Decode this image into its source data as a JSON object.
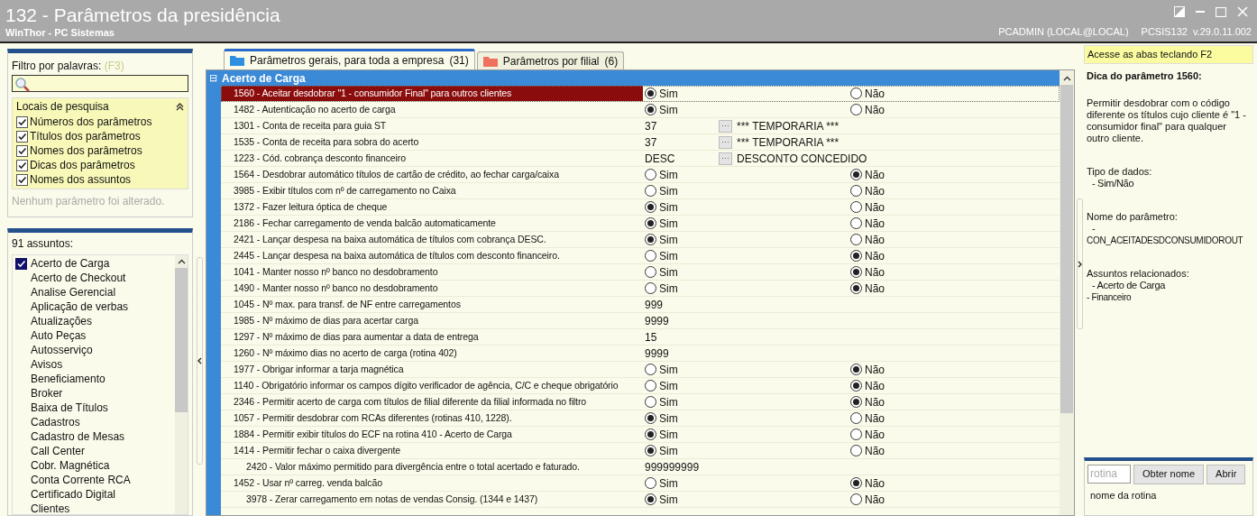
{
  "window": {
    "title": "132 - Parâmetros da presidência",
    "subtitle": "WinThor - PC Sistemas",
    "user": "PCADMIN (LOCAL@LOCAL)",
    "routine": "PCSIS132",
    "version": "v.29.0.11.002"
  },
  "filter": {
    "label": "Filtro por palavras:",
    "shortcut": "(F3)",
    "search_places_title": "Locais de pesquisa",
    "places": [
      {
        "label": "Números dos parâmetros",
        "checked": true
      },
      {
        "label": "Títulos dos parâmetros",
        "checked": true
      },
      {
        "label": "Nomes dos parâmetros",
        "checked": true
      },
      {
        "label": "Dicas dos parâmetros",
        "checked": true
      },
      {
        "label": "Nomes dos assuntos",
        "checked": true
      }
    ],
    "status": "Nenhum parâmetro foi alterado."
  },
  "subjects": {
    "count_label": "91 assuntos:",
    "items": [
      {
        "label": "Acerto de Carga",
        "selected": true
      },
      {
        "label": "Acerto de Checkout",
        "selected": false
      },
      {
        "label": "Analise Gerencial",
        "selected": false
      },
      {
        "label": "Aplicação de verbas",
        "selected": false
      },
      {
        "label": "Atualizações",
        "selected": false
      },
      {
        "label": "Auto Peças",
        "selected": false
      },
      {
        "label": "Autosserviço",
        "selected": false
      },
      {
        "label": "Avisos",
        "selected": false
      },
      {
        "label": "Beneficiamento",
        "selected": false
      },
      {
        "label": "Broker",
        "selected": false
      },
      {
        "label": "Baixa de Títulos",
        "selected": false
      },
      {
        "label": "Cadastros",
        "selected": false
      },
      {
        "label": "Cadastro de Mesas",
        "selected": false
      },
      {
        "label": "Call Center",
        "selected": false
      },
      {
        "label": "Cobr. Magnética",
        "selected": false
      },
      {
        "label": "Conta Corrente RCA",
        "selected": false
      },
      {
        "label": "Certificado Digital",
        "selected": false
      },
      {
        "label": "Clientes",
        "selected": false
      }
    ]
  },
  "tabs": [
    {
      "label": "Parâmetros gerais, para toda a empresa",
      "count": "(31)",
      "selected": true,
      "color": "#2f8fe0"
    },
    {
      "label": "Parâmetros por filial",
      "count": "(6)",
      "selected": false,
      "color": "#f07060"
    }
  ],
  "grid": {
    "group": "Acerto de Carga",
    "expand_glyph": "⊟",
    "rows": [
      {
        "kind": "yesno",
        "label": "1560 - Aceitar desdobrar \"1 - consumidor Final\" para outros clientes",
        "selected": true,
        "options": [
          {
            "label": "Sim",
            "selected": true
          },
          {
            "label": "Não",
            "selected": false
          }
        ]
      },
      {
        "kind": "yesno",
        "label": "1482 - Autenticação no acerto de carga",
        "selected": false,
        "options": [
          {
            "label": "Sim",
            "selected": true
          },
          {
            "label": "Não",
            "selected": false
          }
        ]
      },
      {
        "kind": "lookup",
        "label": "1301 - Conta de receita para guia ST",
        "selected": false,
        "value": "37",
        "button": "···",
        "description": "*** TEMPORARIA ***"
      },
      {
        "kind": "lookup",
        "label": "1535 - Conta de receita para sobra do acerto",
        "selected": false,
        "value": "37",
        "button": "···",
        "description": "*** TEMPORARIA ***"
      },
      {
        "kind": "lookup",
        "label": "1223 - Cód. cobrança desconto financeiro",
        "selected": false,
        "value": "DESC",
        "button": "···",
        "description": "DESCONTO CONCEDIDO"
      },
      {
        "kind": "yesno",
        "label": "1564 - Desdobrar automático títulos de cartão de crédito, ao fechar carga/caixa",
        "selected": false,
        "options": [
          {
            "label": "Sim",
            "selected": false
          },
          {
            "label": "Não",
            "selected": true
          }
        ]
      },
      {
        "kind": "yesno",
        "label": "3985 - Exibir títulos com nº de carregamento no Caixa",
        "selected": false,
        "options": [
          {
            "label": "Sim",
            "selected": false
          },
          {
            "label": "Não",
            "selected": false
          }
        ]
      },
      {
        "kind": "yesno",
        "label": "1372 - Fazer leitura óptica de cheque",
        "selected": false,
        "options": [
          {
            "label": "Sim",
            "selected": true
          },
          {
            "label": "Não",
            "selected": false
          }
        ]
      },
      {
        "kind": "yesno",
        "label": "2186 - Fechar carregamento de venda balcão automaticamente",
        "selected": false,
        "options": [
          {
            "label": "Sim",
            "selected": true
          },
          {
            "label": "Não",
            "selected": false
          }
        ]
      },
      {
        "kind": "yesno",
        "label": "2421 - Lançar despesa na baixa automática de títulos com cobrança DESC.",
        "selected": false,
        "options": [
          {
            "label": "Sim",
            "selected": true
          },
          {
            "label": "Não",
            "selected": false
          }
        ]
      },
      {
        "kind": "yesno",
        "label": "2445 - Lançar despesa na baixa automática de títulos com desconto financeiro.",
        "selected": false,
        "options": [
          {
            "label": "Sim",
            "selected": false
          },
          {
            "label": "Não",
            "selected": true
          }
        ]
      },
      {
        "kind": "yesno",
        "label": "1041 - Manter nosso nº banco no desdobramento",
        "selected": false,
        "options": [
          {
            "label": "Sim",
            "selected": false
          },
          {
            "label": "Não",
            "selected": true
          }
        ]
      },
      {
        "kind": "yesno",
        "label": "1490 - Manter nosso nº banco no desdobramento",
        "selected": false,
        "options": [
          {
            "label": "Sim",
            "selected": false
          },
          {
            "label": "Não",
            "selected": true
          }
        ]
      },
      {
        "kind": "number",
        "label": "1045 - Nº max. para transf. de NF entre carregamentos",
        "selected": false,
        "value": "999"
      },
      {
        "kind": "number",
        "label": "1985 - Nº máximo de dias para acertar carga",
        "selected": false,
        "value": "9999"
      },
      {
        "kind": "number",
        "label": "1297 - Nº máximo de dias para aumentar a data de entrega",
        "selected": false,
        "value": "15"
      },
      {
        "kind": "number",
        "label": "1260 - Nº máximo dias no acerto de carga (rotina 402)",
        "selected": false,
        "value": "9999"
      },
      {
        "kind": "yesno",
        "label": "1977 - Obrigar informar a tarja magnética",
        "selected": false,
        "options": [
          {
            "label": "Sim",
            "selected": false
          },
          {
            "label": "Não",
            "selected": true
          }
        ]
      },
      {
        "kind": "yesno",
        "label": "1140 - Obrigatório informar os campos dígito verificador de agência, C/C e cheque obrigatório",
        "selected": false,
        "options": [
          {
            "label": "Sim",
            "selected": false
          },
          {
            "label": "Não",
            "selected": true
          }
        ]
      },
      {
        "kind": "yesno",
        "label": "2346 - Permitir acerto de carga com títulos de filial diferente da filial informada no filtro",
        "selected": false,
        "options": [
          {
            "label": "Sim",
            "selected": false
          },
          {
            "label": "Não",
            "selected": true
          }
        ]
      },
      {
        "kind": "yesno",
        "label": "1057 - Permitir desdobrar com RCAs diferentes (rotinas 410, 1228).",
        "selected": false,
        "options": [
          {
            "label": "Sim",
            "selected": true
          },
          {
            "label": "Não",
            "selected": false
          }
        ]
      },
      {
        "kind": "yesno",
        "label": "1884 - Permitir exibir títulos do ECF na rotina 410 - Acerto de Carga",
        "selected": false,
        "options": [
          {
            "label": "Sim",
            "selected": true
          },
          {
            "label": "Não",
            "selected": false
          }
        ]
      },
      {
        "kind": "yesno",
        "label": "1414 - Permitir fechar o caixa divergente",
        "selected": false,
        "options": [
          {
            "label": "Sim",
            "selected": true
          },
          {
            "label": "Não",
            "selected": false
          }
        ],
        "children": [
          {
            "kind": "number",
            "label": "2420 - Valor máximo permitido para divergência entre o total acertado e faturado.",
            "selected": false,
            "value": "999999999"
          }
        ]
      },
      {
        "kind": "yesno",
        "label": "1452 - Usar nº carreg. venda balcão",
        "selected": false,
        "options": [
          {
            "label": "Sim",
            "selected": false
          },
          {
            "label": "Não",
            "selected": true
          }
        ],
        "children": [
          {
            "kind": "yesno",
            "label": "3978 - Zerar carregamento em notas de vendas Consig. (1344 e 1437)",
            "selected": false,
            "options": [
              {
                "label": "Sim",
                "selected": true
              },
              {
                "label": "Não",
                "selected": false
              }
            ]
          }
        ]
      }
    ]
  },
  "hint_panel": {
    "shortcut_hint": "Acesse as abas teclando F2",
    "title": "Dica do parâmetro 1560:",
    "description": "Permitir desdobrar com o código diferente os títulos cujo cliente é \"1 - consumidor final\" para qualquer outro cliente.",
    "sections": [
      {
        "heading": "Tipo de dados:",
        "lines": [
          "- Sim/Não"
        ]
      },
      {
        "heading": "Nome do parâmetro:",
        "lines": [
          "-",
          "CON_ACEITADESDCONSUMIDOROUT"
        ]
      },
      {
        "heading": "Assuntos relacionados:",
        "lines": [
          "- Acerto de Carga",
          "- Financeiro"
        ]
      }
    ]
  },
  "routine_lookup": {
    "placeholder": "rotina",
    "buttons": [
      "Obter nome",
      "Abrir"
    ],
    "result": "nome da rotina"
  }
}
